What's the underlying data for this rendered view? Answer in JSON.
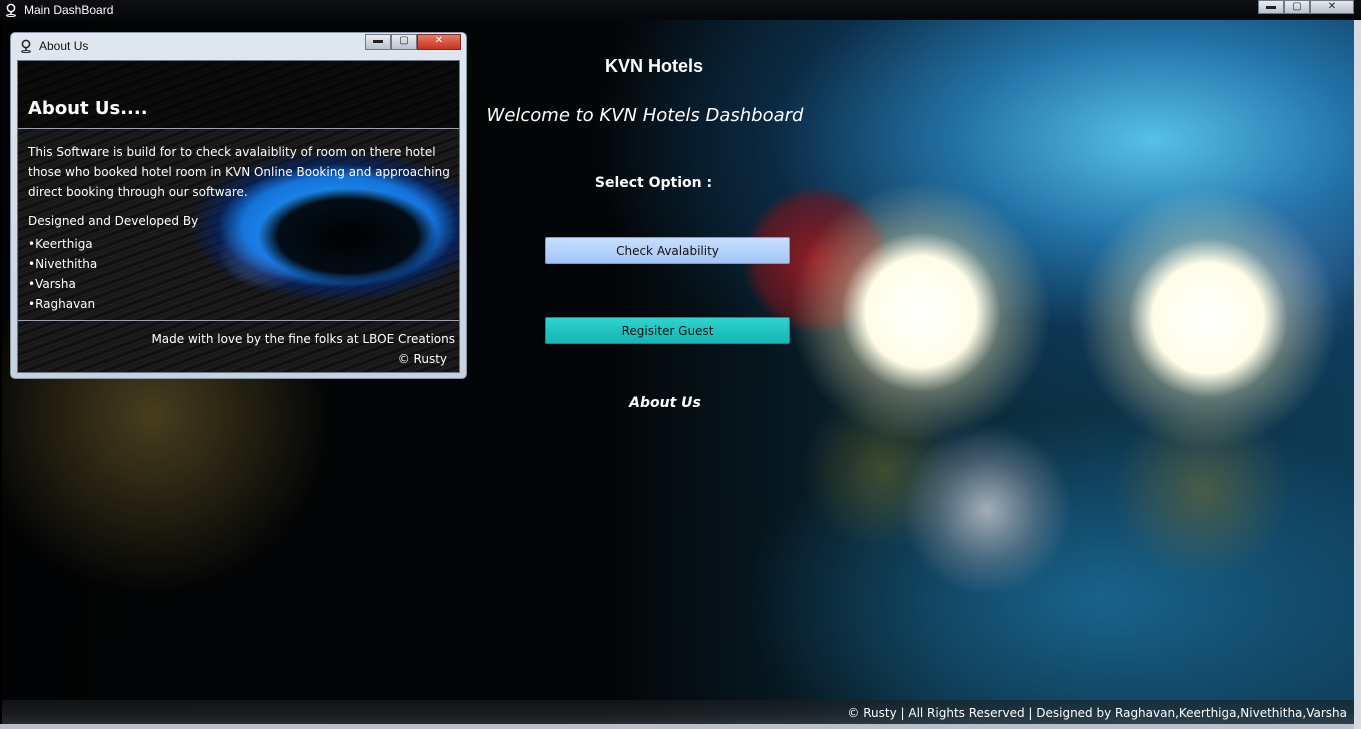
{
  "main_window": {
    "title": "Main DashBoard",
    "controls": {
      "minimize": "▬",
      "maximize": "▢",
      "close": "✕"
    }
  },
  "about_window": {
    "title": "About Us",
    "controls": {
      "minimize": "▬",
      "maximize": "▢",
      "close": "✕"
    },
    "heading": "About Us....",
    "description": "This Software is build for to check avalaiblity of room on there hotel those who booked hotel room in KVN Online Booking and approaching direct booking through our software.",
    "designed_by": "Designed and Developed By",
    "developers": [
      "Keerthiga",
      "Nivethitha",
      "Varsha",
      "Raghavan"
    ],
    "made_with": "Made with love by the fine folks at LBOE Creations",
    "copyright": "© Rusty"
  },
  "dashboard": {
    "title": "KVN Hotels",
    "welcome": "Welcome to KVN Hotels Dashboard",
    "select_label": "Select Option :",
    "check_button": "Check Avalability",
    "register_button": "Regisiter Guest",
    "about_link": "About Us",
    "footer": "© Rusty | All Rights Reserved | Designed by Raghavan,Keerthiga,Nivethitha,Varsha"
  },
  "colors": {
    "check_button": "#a9cbf8",
    "register_button": "#1fc4c1",
    "text": "#ffffff"
  },
  "icons": {
    "app_icon": "location-pin-icon",
    "frame_icon": "location-pin-icon"
  }
}
